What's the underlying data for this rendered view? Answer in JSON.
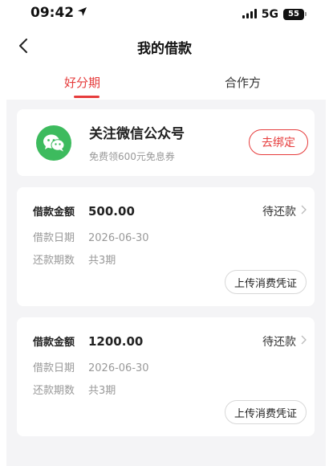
{
  "status_bar": {
    "time": "09:42",
    "network": "5G",
    "battery": "55"
  },
  "nav": {
    "title": "我的借款"
  },
  "tabs": [
    {
      "label": "好分期",
      "active": true
    },
    {
      "label": "合作方",
      "active": false
    }
  ],
  "wechat_banner": {
    "title": "关注微信公众号",
    "subtitle": "免费领600元免息券",
    "button": "去绑定"
  },
  "loans": [
    {
      "amount_label": "借款金额",
      "amount": "500.00",
      "status": "待还款",
      "date_label": "借款日期",
      "date": "2026-06-30",
      "periods_label": "还款期数",
      "periods": "共3期",
      "upload_button": "上传消费凭证"
    },
    {
      "amount_label": "借款金额",
      "amount": "1200.00",
      "status": "待还款",
      "date_label": "借款日期",
      "date": "2026-06-30",
      "periods_label": "还款期数",
      "periods": "共3期",
      "upload_button": "上传消费凭证"
    }
  ],
  "colors": {
    "accent": "#e63c3c",
    "wechat_green": "#3dbb5e",
    "background": "#f4f4f6"
  }
}
